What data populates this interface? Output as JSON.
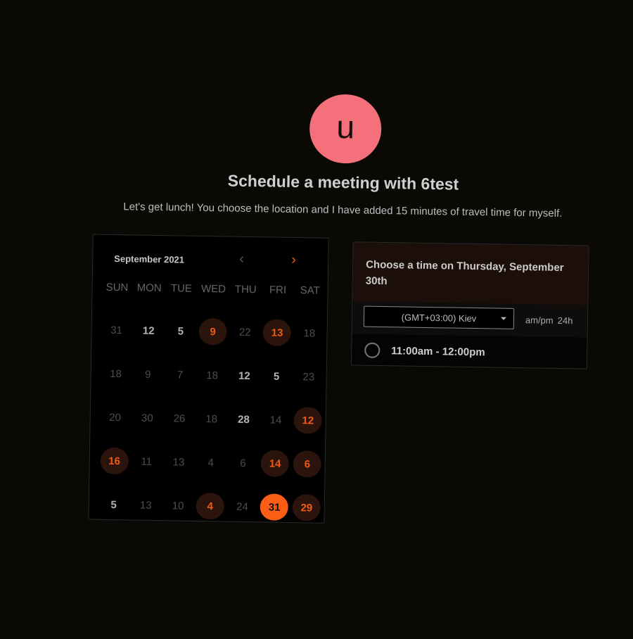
{
  "avatar": {
    "initial": "u",
    "color": "#f4707a"
  },
  "title": "Schedule a meeting with 6test",
  "subtitle": "Let's get lunch! You choose the location and I have added 15 minutes of travel time for myself.",
  "calendar": {
    "month_label": "September 2021",
    "prev_icon": "‹",
    "next_icon": "›",
    "weekdays": [
      "SUN",
      "MON",
      "TUE",
      "WED",
      "THU",
      "FRI",
      "SAT"
    ],
    "days": [
      [
        [
          "31",
          "m"
        ],
        [
          "12",
          "n"
        ],
        [
          "5",
          "n"
        ],
        [
          "9",
          "a"
        ],
        [
          "22",
          "m"
        ],
        [
          "13",
          "a"
        ],
        [
          "18",
          "m"
        ]
      ],
      [
        [
          "18",
          "m"
        ],
        [
          "9",
          "m"
        ],
        [
          "7",
          "m"
        ],
        [
          "18",
          "m"
        ],
        [
          "12",
          "n"
        ],
        [
          "5",
          "n"
        ],
        [
          "23",
          "m"
        ]
      ],
      [
        [
          "20",
          "m"
        ],
        [
          "30",
          "m"
        ],
        [
          "26",
          "m"
        ],
        [
          "18",
          "m"
        ],
        [
          "28",
          "n"
        ],
        [
          "14",
          "m"
        ],
        [
          "12",
          "a"
        ]
      ],
      [
        [
          "16",
          "a"
        ],
        [
          "11",
          "m"
        ],
        [
          "13",
          "m"
        ],
        [
          "4",
          "m"
        ],
        [
          "6",
          "m"
        ],
        [
          "14",
          "a"
        ],
        [
          "6",
          "a"
        ]
      ],
      [
        [
          "5",
          "n"
        ],
        [
          "13",
          "m"
        ],
        [
          "10",
          "m"
        ],
        [
          "4",
          "a"
        ],
        [
          "24",
          "m"
        ],
        [
          "31",
          "s"
        ],
        [
          "29",
          "a"
        ]
      ]
    ],
    "accent": "#f95d16"
  },
  "panel": {
    "heading": "Choose a time on Thursday, September 30th",
    "timezone": "(GMT+03:00) Kiev",
    "format_ampm": "am/pm",
    "format_24h": "24h",
    "slots": [
      "11:00am - 12:00pm"
    ]
  }
}
